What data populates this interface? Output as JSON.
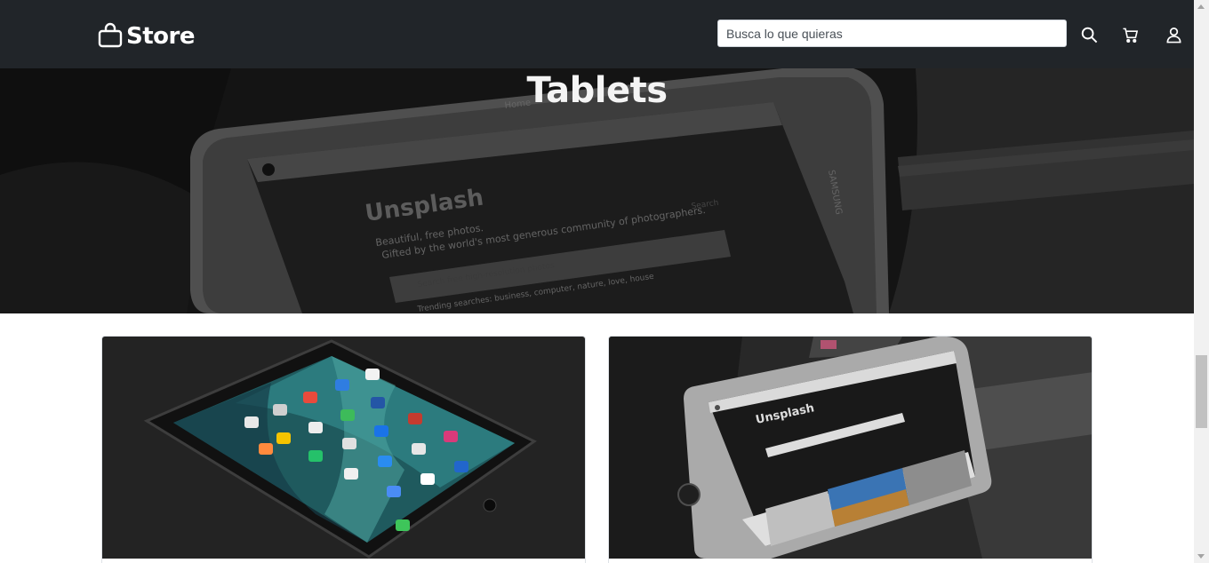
{
  "navbar": {
    "brand_label": "Store",
    "search": {
      "placeholder": "Busca lo que quieras",
      "value": ""
    },
    "icons": [
      "search-icon",
      "cart-icon",
      "user-icon"
    ]
  },
  "hero": {
    "title": "Tablets",
    "screen_texts": {
      "nav_home": "Home",
      "site_name": "Unsplash",
      "tagline_1": "Beautiful, free photos.",
      "tagline_2": "Gifted by the world's most generous community of photographers.",
      "search_placeholder": "Search free high-resolution photos",
      "trending": "Trending searches: business, computer, nature, love, house",
      "search_button": "Search",
      "brand_side": "SAMSUNG"
    }
  },
  "products": [
    {
      "image": "ipad-home-screen-photo"
    },
    {
      "image": "samsung-tablet-unsplash-photo",
      "screen_title": "Unsplash"
    }
  ],
  "colors": {
    "navbar_bg": "#212529",
    "hero_overlay": "#000000",
    "page_bg": "#ffffff"
  }
}
